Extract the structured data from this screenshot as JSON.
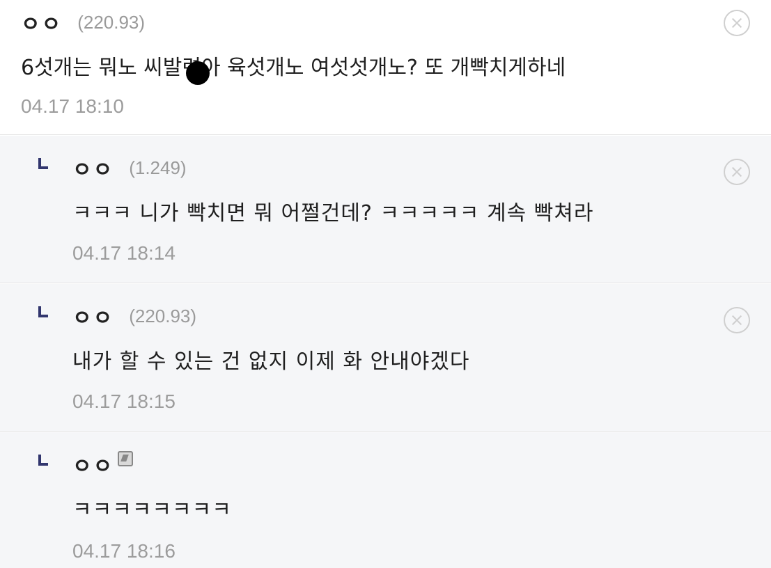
{
  "comments": [
    {
      "nick": "ㅇㅇ",
      "ip": "(220.93)",
      "text": "6섯개는 뭐노 씨발련아 육섯개노 여섯섯개노? 또 개빡치게하네",
      "date": "04.17 18:10"
    },
    {
      "nick": "ㅇㅇ",
      "ip": "(1.249)",
      "text": "ㅋㅋㅋ 니가 빡치면 뭐 어쩔건데? ㅋㅋㅋㅋㅋ 계속 빡쳐라",
      "date": "04.17 18:14"
    },
    {
      "nick": "ㅇㅇ",
      "ip": "(220.93)",
      "text": "내가 할 수 있는 건 없지 이제 화 안내야겠다",
      "date": "04.17 18:15"
    },
    {
      "nick": "ㅇㅇ",
      "text": "ㅋㅋㅋㅋㅋㅋㅋㅋ",
      "date": "04.17 18:16"
    }
  ],
  "icons": {
    "delete": "close-circle-icon",
    "reply": "reply-arrow-icon",
    "member": "member-badge-icon"
  }
}
